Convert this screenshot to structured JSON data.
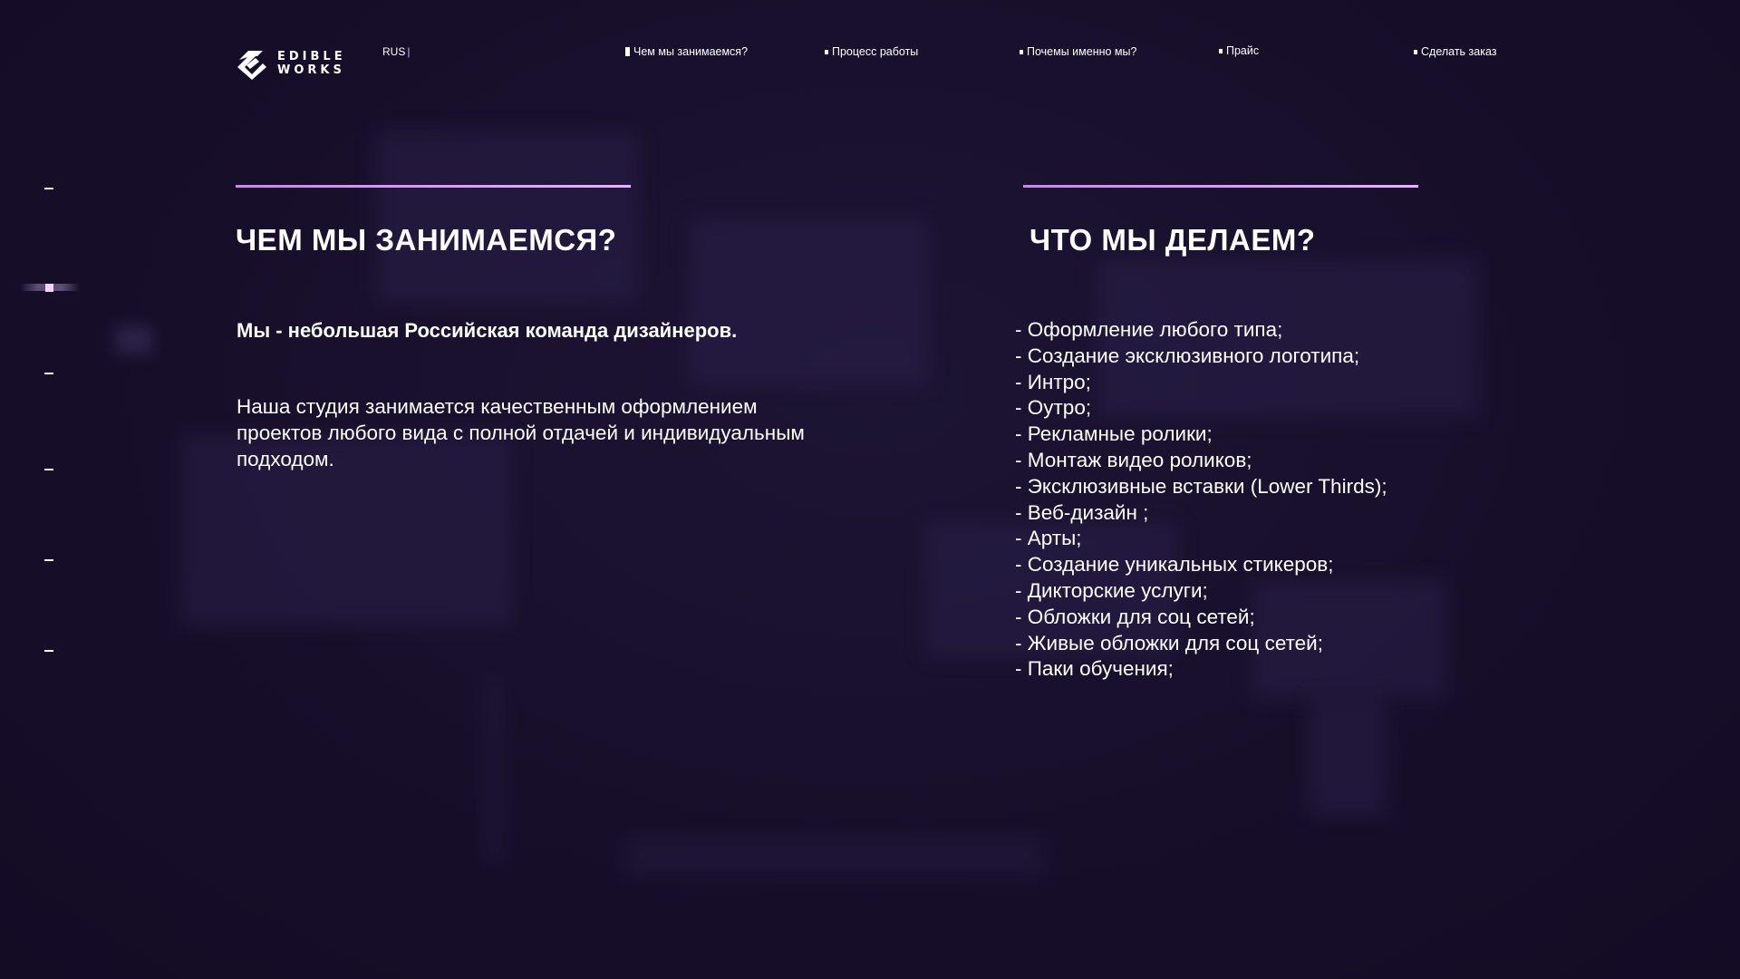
{
  "header": {
    "logo": {
      "line1": "EDIBLE",
      "line2": "WORKS"
    },
    "lang": "RUS",
    "lang_separator": "|",
    "nav": [
      {
        "label": "Чем мы занимаемся?",
        "active": true
      },
      {
        "label": "Процесс работы",
        "active": false
      },
      {
        "label": "Почемы именно мы?",
        "active": false
      },
      {
        "label": "Прайс",
        "active": false
      },
      {
        "label": "Сделать заказ",
        "active": false
      }
    ]
  },
  "side_nav": {
    "count": 6,
    "active_index": 1
  },
  "about": {
    "heading": "ЧЕМ МЫ ЗАНИМАЕМСЯ?",
    "lead": "Мы - небольшая Российская команда дизайнеров.",
    "body": "Наша студия занимается качественным оформлением проектов любого вида с полной отдачей и индивидуальным подходом."
  },
  "services": {
    "heading": "ЧТО МЫ ДЕЛАЕМ?",
    "items": [
      "- Оформление любого типа;",
      "- Создание эксклюзивного логотипа;",
      "- Интро;",
      "- Оутро;",
      "- Рекламные ролики;",
      "- Монтаж видео роликов;",
      "- Эксклюзивные вставки (Lower Thirds);",
      "- Веб-дизайн ;",
      "- Арты;",
      "- Создание уникальных стикеров;",
      "- Дикторские услуги;",
      "- Обложки для соц сетей;",
      "- Живые обложки для соц сетей;",
      "- Паки обучения;"
    ]
  },
  "colors": {
    "background": "#17102a",
    "accent": "#d9a0f5",
    "text": "#ffffff"
  }
}
